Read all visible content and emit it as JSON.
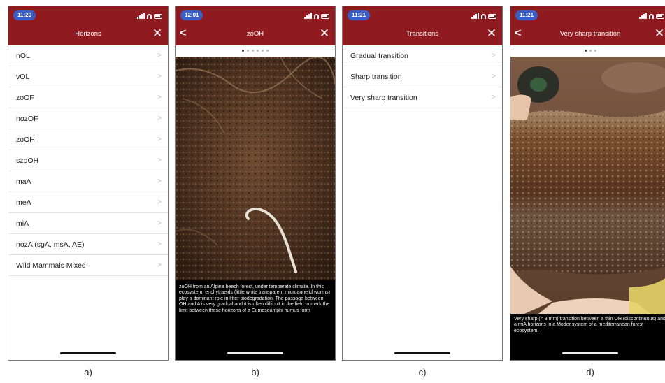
{
  "panels": [
    {
      "time": "11:20",
      "title": "Horizons",
      "items": [
        "nOL",
        "vOL",
        "zoOF",
        "nozOF",
        "zoOH",
        "szoOH",
        "maA",
        "meA",
        "miA",
        "nozA (sgA, msA, AE)",
        "Wild Mammals Mixed"
      ],
      "figure_label": "a)"
    },
    {
      "time": "12:01",
      "title": "zoOH",
      "caption": "zoOH from an Alpine beech forest, under temperate climate. In this ecosystem, enchytraeids (little white transparent microannelid worms) play a dominant role in litter biodegradation. The passage between OH and A is very gradual and it is often difficult in the field to mark the limit between these horizons of a Eumesoamphi humus form",
      "figure_label": "b)"
    },
    {
      "time": "11:21",
      "title": "Transitions",
      "items": [
        "Gradual transition",
        "Sharp transition",
        "Very sharp transition"
      ],
      "figure_label": "c)"
    },
    {
      "time": "11:21",
      "title": "Very sharp transition",
      "caption": "Very sharp (< 3 mm) transition between a thin OH (discontinuous) and a miA horizons in a Moder system of a mediterranean forest ecosystem.",
      "figure_label": "d)"
    }
  ],
  "colors": {
    "header": "#8f1b20",
    "time_pill": "#3b5ec6",
    "caption_bg": "#000000"
  },
  "icons": {
    "close": "close-icon",
    "back": "back-chevron-icon",
    "chevron": "chevron-right-icon"
  }
}
